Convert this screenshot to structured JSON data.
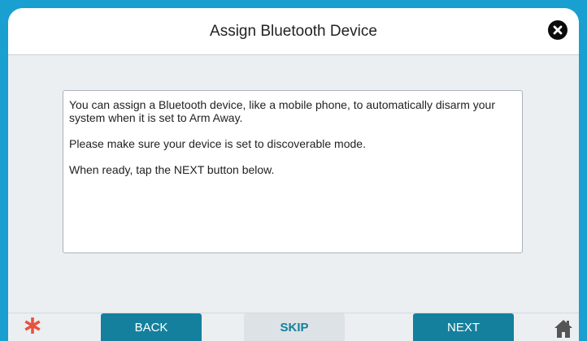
{
  "dialog": {
    "title": "Assign Bluetooth Device",
    "close_icon": "close-icon"
  },
  "content": {
    "paragraphs": [
      "You can assign a Bluetooth device, like a mobile phone, to automatically disarm your system when it is set to Arm Away.",
      "Please make sure your device is set to discoverable mode.",
      "When ready, tap the NEXT button below."
    ]
  },
  "footer": {
    "emergency_icon": "asterisk-icon",
    "back_label": "BACK",
    "skip_label": "SKIP",
    "next_label": "NEXT",
    "home_icon": "home-icon"
  },
  "colors": {
    "background": "#1a9fd1",
    "primary_button": "#14809d",
    "secondary_button": "#dde2e6",
    "emergency": "#e8533f",
    "home": "#555555"
  }
}
